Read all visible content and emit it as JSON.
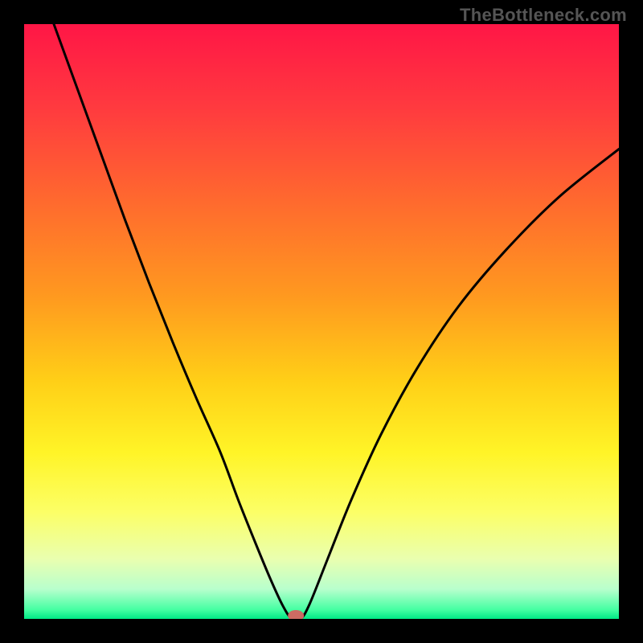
{
  "watermark": "TheBottleneck.com",
  "chart_data": {
    "type": "line",
    "title": "",
    "xlabel": "",
    "ylabel": "",
    "xlim": [
      0,
      100
    ],
    "ylim": [
      0,
      100
    ],
    "gradient_stops": [
      {
        "offset": 0.0,
        "color": "#ff1646"
      },
      {
        "offset": 0.14,
        "color": "#ff3a3f"
      },
      {
        "offset": 0.3,
        "color": "#ff6a2e"
      },
      {
        "offset": 0.46,
        "color": "#ff9a1f"
      },
      {
        "offset": 0.6,
        "color": "#ffcf17"
      },
      {
        "offset": 0.72,
        "color": "#fff427"
      },
      {
        "offset": 0.82,
        "color": "#fcff66"
      },
      {
        "offset": 0.9,
        "color": "#e9ffb0"
      },
      {
        "offset": 0.95,
        "color": "#b8ffcd"
      },
      {
        "offset": 0.985,
        "color": "#43ffa2"
      },
      {
        "offset": 1.0,
        "color": "#00e985"
      }
    ],
    "curve_points": [
      {
        "x": 5.0,
        "y": 100.0
      },
      {
        "x": 9.0,
        "y": 89.0
      },
      {
        "x": 13.0,
        "y": 78.0
      },
      {
        "x": 17.0,
        "y": 67.0
      },
      {
        "x": 21.0,
        "y": 56.5
      },
      {
        "x": 25.0,
        "y": 46.5
      },
      {
        "x": 29.0,
        "y": 37.0
      },
      {
        "x": 33.0,
        "y": 28.0
      },
      {
        "x": 36.0,
        "y": 20.0
      },
      {
        "x": 39.0,
        "y": 12.5
      },
      {
        "x": 41.5,
        "y": 6.5
      },
      {
        "x": 43.5,
        "y": 2.2
      },
      {
        "x": 45.0,
        "y": 0.0
      },
      {
        "x": 46.5,
        "y": 0.0
      },
      {
        "x": 48.0,
        "y": 2.5
      },
      {
        "x": 51.0,
        "y": 10.0
      },
      {
        "x": 55.0,
        "y": 20.0
      },
      {
        "x": 60.0,
        "y": 31.0
      },
      {
        "x": 66.0,
        "y": 42.0
      },
      {
        "x": 73.0,
        "y": 52.5
      },
      {
        "x": 81.0,
        "y": 62.0
      },
      {
        "x": 90.0,
        "y": 71.0
      },
      {
        "x": 100.0,
        "y": 79.0
      }
    ],
    "marker": {
      "x": 45.7,
      "y": 0.0,
      "color": "#cc6b63"
    }
  }
}
